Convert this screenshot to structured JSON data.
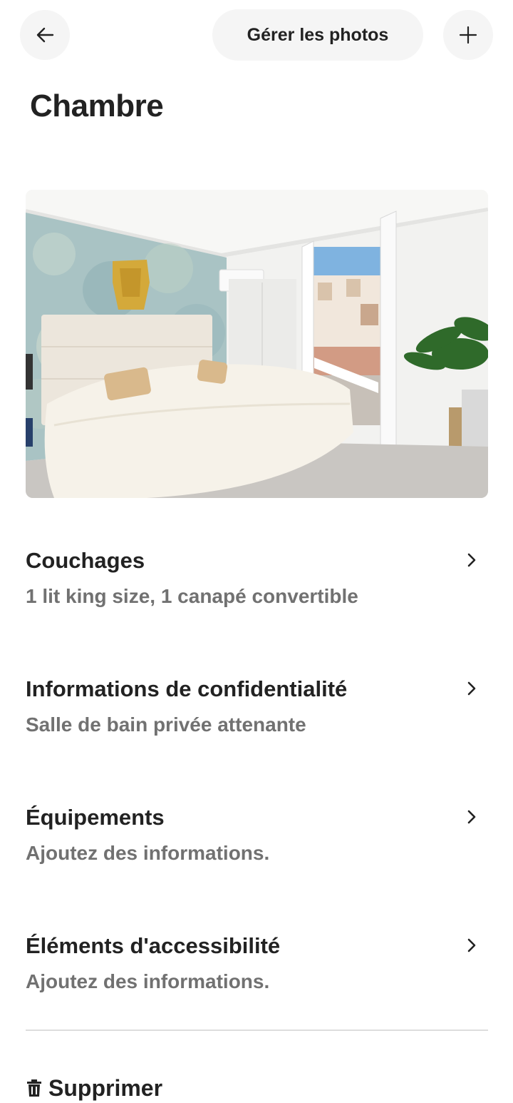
{
  "header": {
    "back_icon": "arrow-left-icon",
    "manage_photos_label": "Gérer les photos",
    "add_icon": "plus-icon"
  },
  "page_title": "Chambre",
  "photo": {
    "subject": "bedroom-photo"
  },
  "rows": [
    {
      "title": "Couchages",
      "subtitle": "1 lit king size, 1 canapé convertible"
    },
    {
      "title": "Informations de confidentialité",
      "subtitle": "Salle de bain privée attenante"
    },
    {
      "title": "Équipements",
      "subtitle": "Ajoutez des informations."
    },
    {
      "title": "Éléments d'accessibilité",
      "subtitle": "Ajoutez des informations."
    }
  ],
  "delete": {
    "icon": "trash-icon",
    "label": "Supprimer"
  },
  "colors": {
    "text_primary": "#222222",
    "text_secondary": "#717171",
    "button_bg": "#f5f5f5",
    "divider": "#dddddd"
  }
}
